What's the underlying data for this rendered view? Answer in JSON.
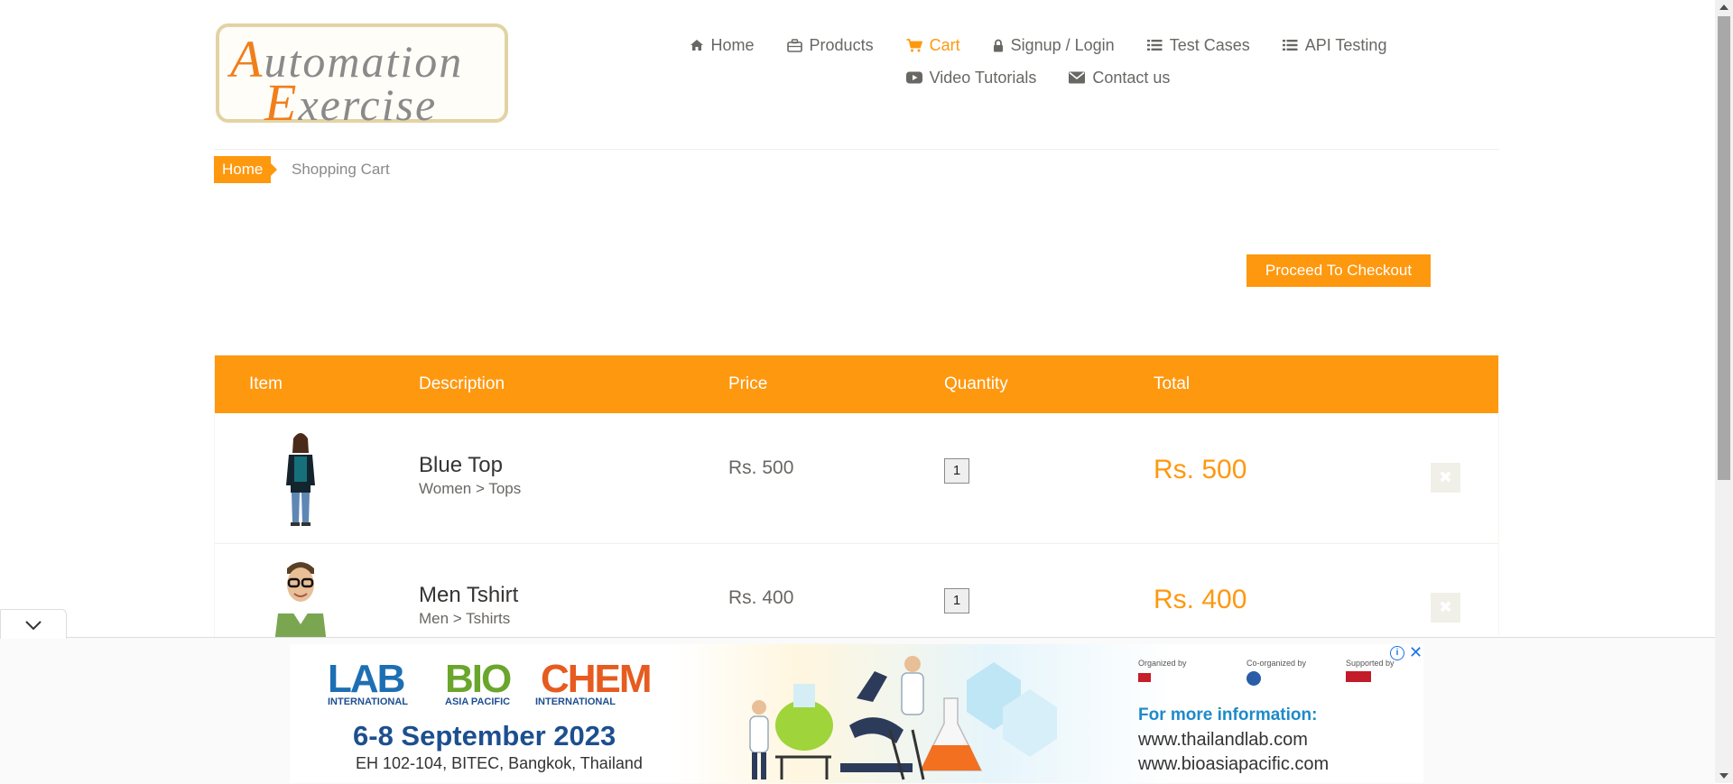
{
  "logo": {
    "line1": "Automation",
    "line2": "Exercise",
    "cap1": "A",
    "rest1": "utomation",
    "cap2": "E",
    "rest2": "xercise"
  },
  "nav": {
    "items": [
      {
        "label": "Home",
        "icon": "home-icon"
      },
      {
        "label": "Products",
        "icon": "briefcase-icon"
      },
      {
        "label": "Cart",
        "icon": "cart-icon",
        "active": true
      },
      {
        "label": "Signup / Login",
        "icon": "lock-icon"
      },
      {
        "label": "Test Cases",
        "icon": "list-icon"
      },
      {
        "label": "API Testing",
        "icon": "list-icon"
      },
      {
        "label": "Video Tutorials",
        "icon": "youtube-play-icon"
      },
      {
        "label": "Contact us",
        "icon": "envelope-icon"
      }
    ]
  },
  "breadcrumb": {
    "home": "Home",
    "current": "Shopping Cart"
  },
  "checkout": {
    "label": "Proceed To Checkout"
  },
  "cart": {
    "headers": {
      "item": "Item",
      "description": "Description",
      "price": "Price",
      "quantity": "Quantity",
      "total": "Total"
    },
    "rows": [
      {
        "name": "Blue Top",
        "category": "Women > Tops",
        "price": "Rs. 500",
        "quantity": "1",
        "total": "Rs. 500",
        "delete": "✖"
      },
      {
        "name": "Men Tshirt",
        "category": "Men > Tshirts",
        "price": "Rs. 400",
        "quantity": "1",
        "total": "Rs. 400",
        "delete": "✖"
      }
    ]
  },
  "ad": {
    "lab": "LAB",
    "lab_sub": "INTERNATIONAL",
    "bio": "BIO",
    "bio_sub": "ASIA PACIFIC",
    "chem": "CHEM",
    "chem_sub": "INTERNATIONAL",
    "dates": "6-8 September 2023",
    "venue": "EH 102-104, BITEC, Bangkok, Thailand",
    "organized_by": "Organized by",
    "co_organized_by": "Co-organized by",
    "supported_by": "Supported by",
    "more_info": "For more information:",
    "url1": "www.thailandlab.com",
    "url2": "www.bioasiapacific.com",
    "info_glyph": "i",
    "close_glyph": "✕"
  },
  "colors": {
    "accent": "#fe980f",
    "text": "#696763",
    "link_blue": "#1a73e8"
  }
}
